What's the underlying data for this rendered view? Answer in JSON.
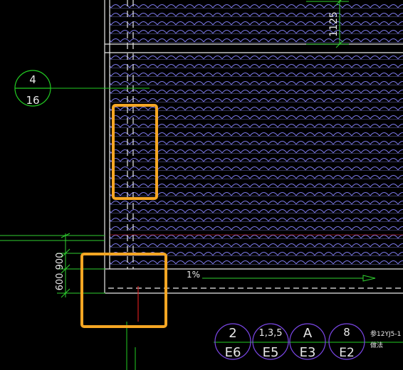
{
  "drawing": {
    "background_color": "#000000",
    "roof_tile_color": "#7b78e8",
    "boundary_line_color": "#e8e8e8",
    "dimension_color": "#2fd12f",
    "leader_color": "#22cc22",
    "red_line_color": "#d21d1d",
    "highlight_color": "#f5a623",
    "bubble_color": "#7a46e6"
  },
  "dimensions": {
    "top_right": "1125",
    "left_upper": "900",
    "left_lower": "600"
  },
  "slope": {
    "label": "1%"
  },
  "detail_callout_left": {
    "top": "4",
    "bottom": "16"
  },
  "legend_bubbles": [
    {
      "top": "2",
      "bottom": "E6"
    },
    {
      "top": "1,3,5",
      "bottom": "E5"
    },
    {
      "top": "A",
      "bottom": "E3"
    },
    {
      "top": "8",
      "bottom": "E2"
    }
  ],
  "legend_note": {
    "line1": "参12YJ5-1",
    "line2": "做法"
  }
}
